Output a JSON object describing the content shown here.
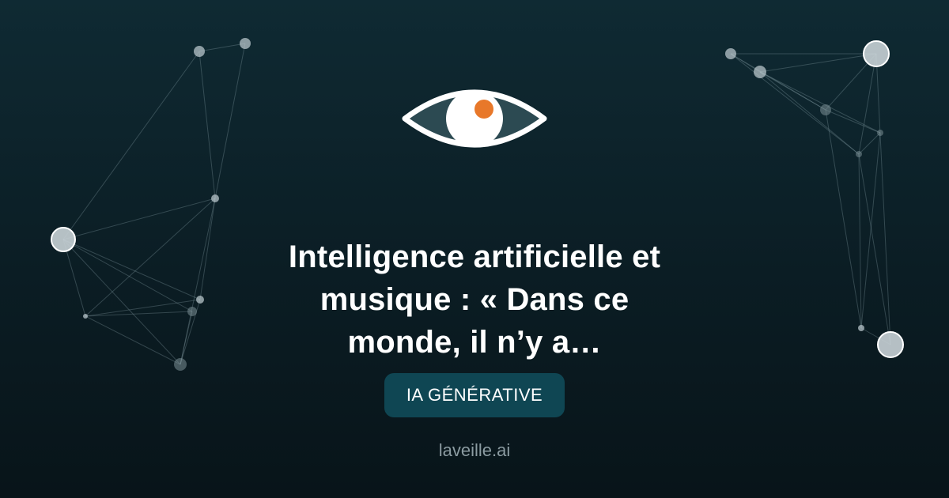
{
  "logo": {
    "icon": "eye-icon",
    "pupil_color": "#e8782a"
  },
  "article": {
    "title_lines": [
      "Intelligence artificielle et",
      "musique : « Dans ce",
      "monde, il n’y a…"
    ],
    "category": "IA GÉNÉRATIVE"
  },
  "site": {
    "name": "laveille.ai"
  },
  "colors": {
    "background": "#0b1d24",
    "tag_background": "#0f4653"
  }
}
